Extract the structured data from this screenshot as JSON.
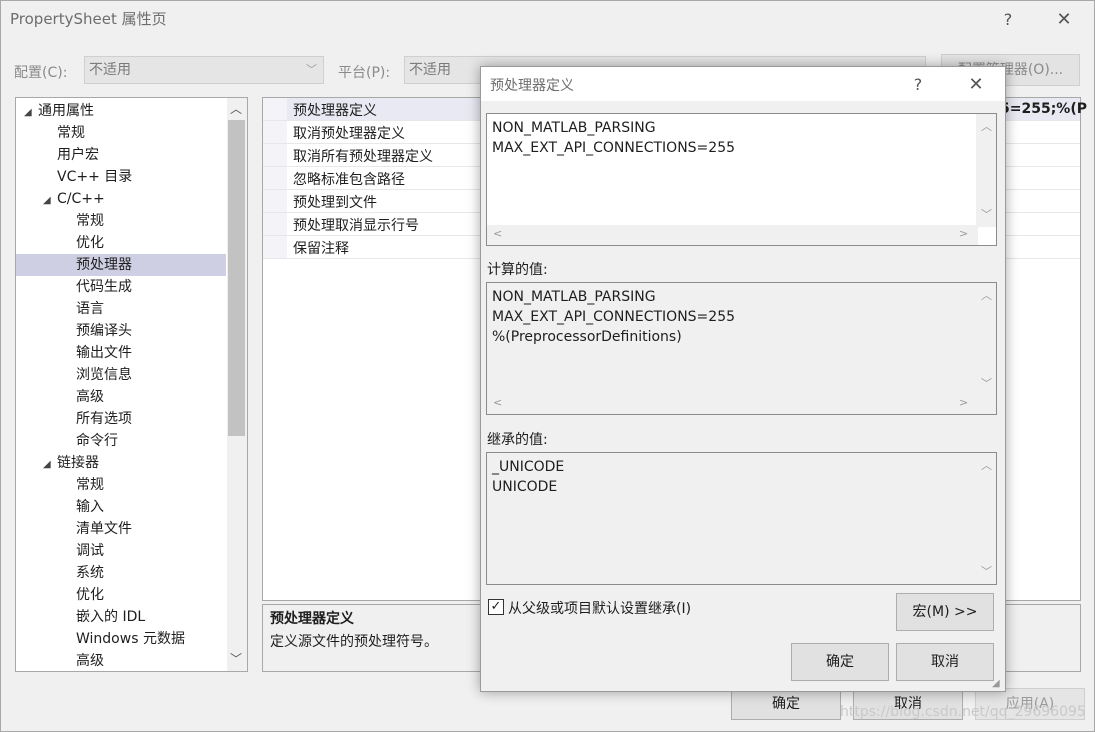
{
  "main": {
    "title": "PropertySheet 属性页",
    "help": "?",
    "close": "✕",
    "config_label": "配置(C):",
    "config_value": "不适用",
    "platform_label": "平台(P):",
    "platform_value": "不适用",
    "config_manager": "配置管理器(O)...",
    "ok": "确定",
    "cancel": "取消",
    "apply": "应用(A)",
    "watermark": "https://blog.csdn.net/qq_29696095"
  },
  "tree": {
    "items": [
      {
        "label": "通用属性",
        "indent": 0,
        "expanded": true
      },
      {
        "label": "常规",
        "indent": 1
      },
      {
        "label": "用户宏",
        "indent": 1
      },
      {
        "label": "VC++ 目录",
        "indent": 1
      },
      {
        "label": "C/C++",
        "indent": 1,
        "expanded": true
      },
      {
        "label": "常规",
        "indent": 2
      },
      {
        "label": "优化",
        "indent": 2
      },
      {
        "label": "预处理器",
        "indent": 2,
        "selected": true
      },
      {
        "label": "代码生成",
        "indent": 2
      },
      {
        "label": "语言",
        "indent": 2
      },
      {
        "label": "预编译头",
        "indent": 2
      },
      {
        "label": "输出文件",
        "indent": 2
      },
      {
        "label": "浏览信息",
        "indent": 2
      },
      {
        "label": "高级",
        "indent": 2
      },
      {
        "label": "所有选项",
        "indent": 2
      },
      {
        "label": "命令行",
        "indent": 2
      },
      {
        "label": "链接器",
        "indent": 1,
        "expanded": true
      },
      {
        "label": "常规",
        "indent": 2
      },
      {
        "label": "输入",
        "indent": 2
      },
      {
        "label": "清单文件",
        "indent": 2
      },
      {
        "label": "调试",
        "indent": 2
      },
      {
        "label": "系统",
        "indent": 2
      },
      {
        "label": "优化",
        "indent": 2
      },
      {
        "label": "嵌入的 IDL",
        "indent": 2
      },
      {
        "label": "Windows 元数据",
        "indent": 2
      },
      {
        "label": "高级",
        "indent": 2
      }
    ]
  },
  "properties": [
    {
      "name": "预处理器定义",
      "value": "5=255;%(P"
    },
    {
      "name": "取消预处理器定义"
    },
    {
      "name": "取消所有预处理器定义"
    },
    {
      "name": "忽略标准包含路径"
    },
    {
      "name": "预处理到文件"
    },
    {
      "name": "预处理取消显示行号"
    },
    {
      "name": "保留注释"
    }
  ],
  "description": {
    "title": "预处理器定义",
    "text": "定义源文件的预处理符号。"
  },
  "dialog": {
    "title": "预处理器定义",
    "help": "?",
    "close": "✕",
    "edit_text": "NON_MATLAB_PARSING\nMAX_EXT_API_CONNECTIONS=255",
    "computed_label": "计算的值:",
    "computed_text": "NON_MATLAB_PARSING\nMAX_EXT_API_CONNECTIONS=255\n%(PreprocessorDefinitions)",
    "inherited_label": "继承的值:",
    "inherited_text": "_UNICODE\nUNICODE",
    "inherit_checked": true,
    "inherit_label": "从父级或项目默认设置继承(I)",
    "macro_button": "宏(M) >>",
    "ok": "确定",
    "cancel": "取消"
  }
}
